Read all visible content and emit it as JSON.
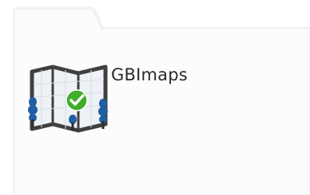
{
  "app": {
    "name": "GBImaps",
    "icon": "map-check-icon",
    "status_icon": "checkmark-circle-icon",
    "colors": {
      "map_frame": "#3f3f3f",
      "map_fill": "#eef1f5",
      "map_grid": "#d7dde6",
      "tree": "#1f5fa3",
      "check_bg": "#3fae2a",
      "folder_bg": "#fafafa",
      "folder_border": "#e8e8e8"
    }
  }
}
